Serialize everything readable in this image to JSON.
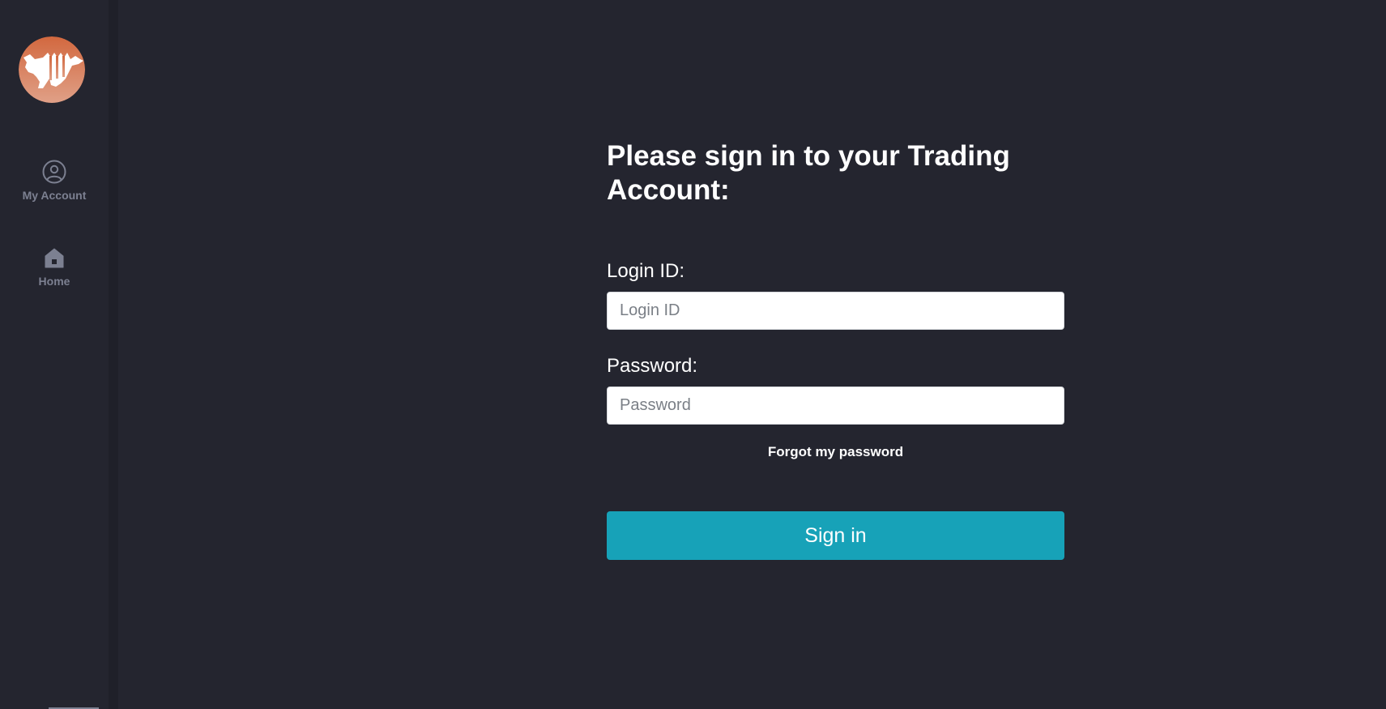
{
  "app": {
    "logo_icon": "bull-logo-icon",
    "accent_color": "#17a2b8",
    "logo_color": "#d9775a"
  },
  "sidebar": {
    "items": [
      {
        "label": "My Account",
        "icon": "user-circle-icon"
      },
      {
        "label": "Home",
        "icon": "home-icon"
      }
    ]
  },
  "login_form": {
    "title": "Please sign in to your Trading Account:",
    "login_label": "Login ID:",
    "login_placeholder": "Login ID",
    "login_value": "",
    "password_label": "Password:",
    "password_placeholder": "Password",
    "password_value": "",
    "forgot_link": "Forgot my password",
    "signin_label": "Sign in"
  }
}
